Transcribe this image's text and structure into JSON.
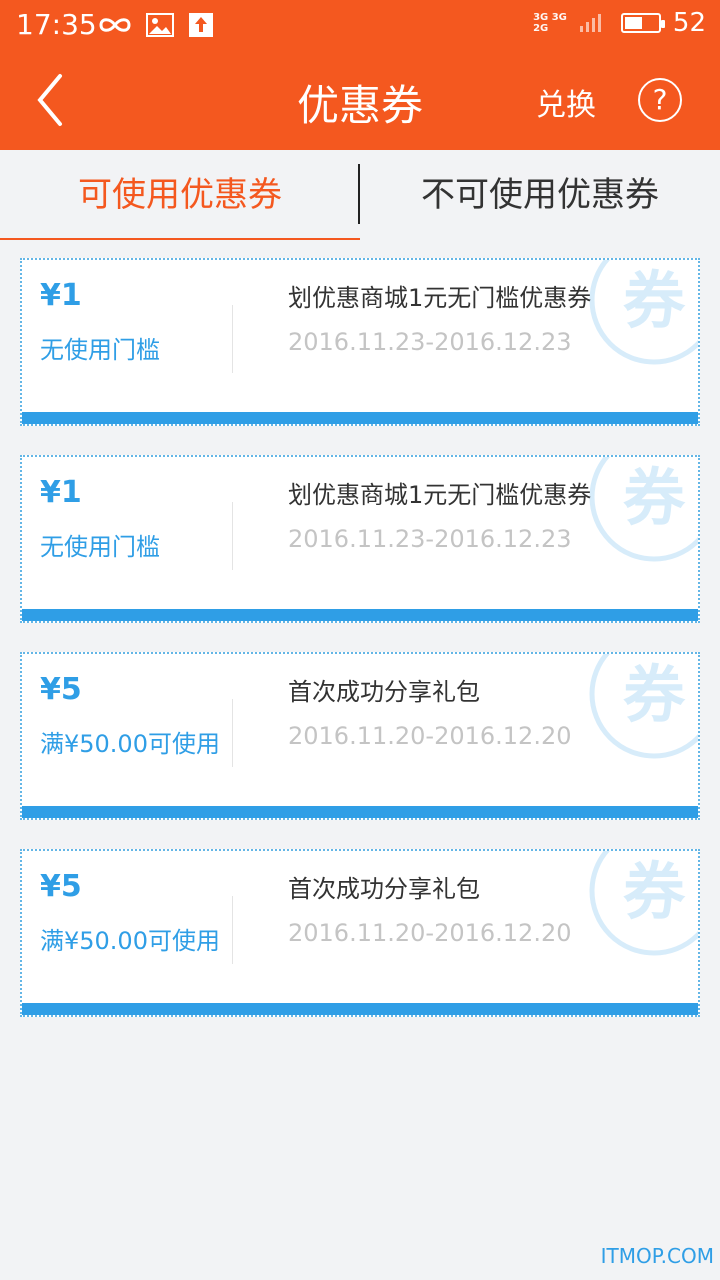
{
  "status_bar": {
    "time": "17:35",
    "battery": "52",
    "battery_level": 0.52,
    "signal_top": "3G 3G",
    "signal_bottom": "2G",
    "icons": [
      "infinity-icon",
      "image-icon",
      "upload-icon"
    ]
  },
  "nav": {
    "title": "优惠券",
    "exchange_label": "兑换",
    "help_label": "?"
  },
  "tabs": [
    {
      "label": "可使用优惠券",
      "active": true
    },
    {
      "label": "不可使用优惠券",
      "active": false
    }
  ],
  "coupons": [
    {
      "amount": "¥1",
      "condition": "无使用门槛",
      "title": "划优惠商城1元无门槛优惠券",
      "date": "2016.11.23-2016.12.23",
      "badge": "券"
    },
    {
      "amount": "¥1",
      "condition": "无使用门槛",
      "title": "划优惠商城1元无门槛优惠券",
      "date": "2016.11.23-2016.12.23",
      "badge": "券"
    },
    {
      "amount": "¥5",
      "condition": "满¥50.00可使用",
      "title": "首次成功分享礼包",
      "date": "2016.11.20-2016.12.20",
      "badge": "券"
    },
    {
      "amount": "¥5",
      "condition": "满¥50.00可使用",
      "title": "首次成功分享礼包",
      "date": "2016.11.20-2016.12.20",
      "badge": "券"
    }
  ],
  "colors": {
    "brand": "#f4581f",
    "coupon_accent": "#2f9ee6"
  },
  "watermark": "ITMOP.COM"
}
